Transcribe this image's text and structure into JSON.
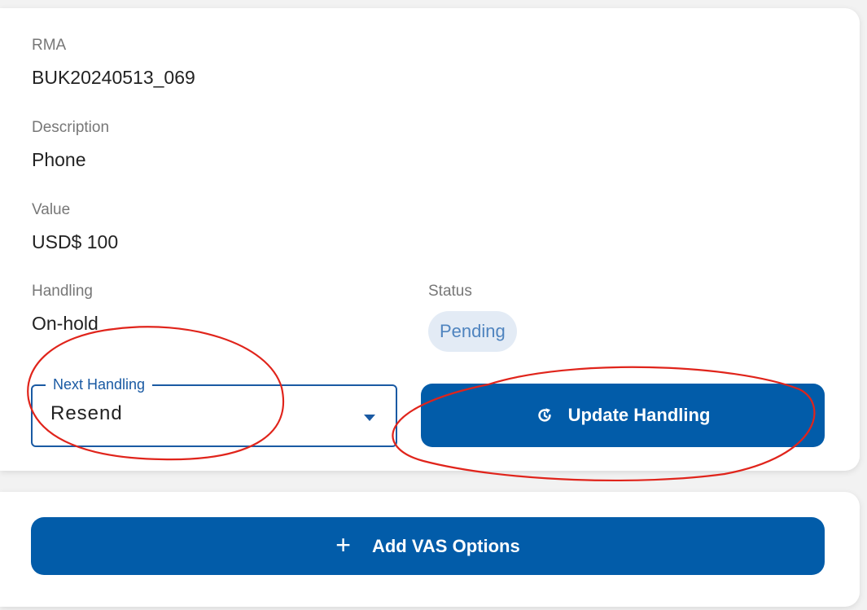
{
  "details": {
    "rma_label": "RMA",
    "rma_value": "BUK20240513_069",
    "description_label": "Description",
    "description_value": "Phone",
    "value_label": "Value",
    "value_value": "USD$ 100",
    "handling_label": "Handling",
    "handling_value": "On-hold",
    "status_label": "Status",
    "status_value": "Pending"
  },
  "next_handling": {
    "label": "Next Handling",
    "selected": "Resend"
  },
  "actions": {
    "update_label": "Update Handling",
    "update_icon": "refresh-icon",
    "add_vas_label": "Add VAS Options",
    "add_vas_icon": "plus-icon"
  },
  "colors": {
    "primary": "#025ca9",
    "status_chip_bg": "#e3ebf5",
    "status_chip_text": "#4f84bf",
    "annotation": "#e0241b"
  }
}
